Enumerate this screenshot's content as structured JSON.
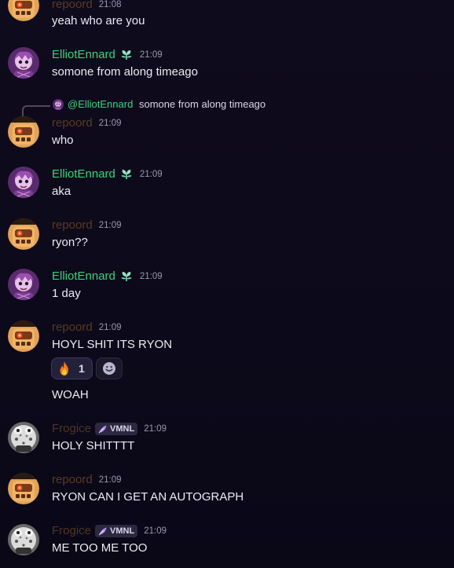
{
  "users": {
    "repoord": "repoord",
    "elliot": "ElliotEnnard",
    "frog": "Frogice"
  },
  "tags": {
    "frog_tag": "VMNL"
  },
  "icons": {
    "elliot_badge": "leaf-badge-icon",
    "frog_tag_icon": "feather-icon",
    "reaction_emoji": "fire-icon",
    "add_reaction": "smile-icon"
  },
  "colors": {
    "elliot_name": "#3bd27a",
    "repoord_name": "#5a3a22",
    "frog_name": "#4d3520",
    "background": "#0d0a1b"
  },
  "messages": [
    {
      "author": "repoord",
      "time": "21:08",
      "text": "yeah who are you"
    },
    {
      "author": "ElliotEnnard",
      "time": "21:09",
      "text": "somone from along timeago"
    },
    {
      "author": "repoord",
      "time": "21:09",
      "text": "who",
      "reply": {
        "name": "@ElliotEnnard",
        "text": "somone from along timeago"
      }
    },
    {
      "author": "ElliotEnnard",
      "time": "21:09",
      "text": "aka"
    },
    {
      "author": "repoord",
      "time": "21:09",
      "text": "ryon??"
    },
    {
      "author": "ElliotEnnard",
      "time": "21:09",
      "text": "1 day"
    },
    {
      "author": "repoord",
      "time": "21:09",
      "text": "HOYL SHIT ITS RYON",
      "reactions": [
        {
          "emoji": "fire",
          "count": "1"
        }
      ],
      "followup": "WOAH"
    },
    {
      "author": "Frogice",
      "time": "21:09",
      "text": "HOLY SHITTTT"
    },
    {
      "author": "repoord",
      "time": "21:09",
      "text": "RYON CAN I GET AN AUTOGRAPH"
    },
    {
      "author": "Frogice",
      "time": "21:09",
      "text": "ME TOO ME TOO"
    }
  ]
}
